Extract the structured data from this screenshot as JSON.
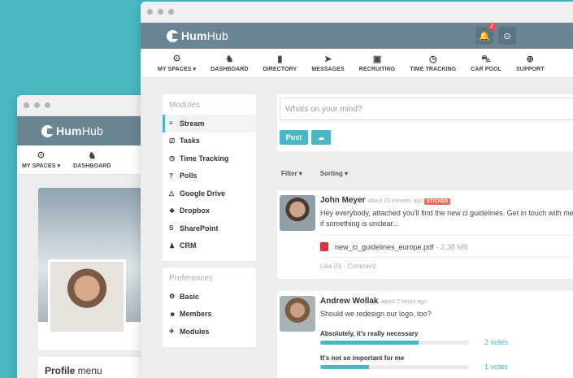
{
  "brand": {
    "logo_prefix": "Hum",
    "logo_suffix": "Hub"
  },
  "back_window": {
    "nav": [
      {
        "icon": "⊙",
        "label": "MY SPACES ▾"
      },
      {
        "icon": "♞",
        "label": "DASHBOARD"
      }
    ],
    "profile_menu": {
      "bold": "Profile",
      "rest": " menu"
    }
  },
  "front_window": {
    "notification_count": "2",
    "nav": [
      {
        "icon": "⊙",
        "label": "MY SPACES ▾"
      },
      {
        "icon": "♞",
        "label": "DASHBOARD"
      },
      {
        "icon": "▮",
        "label": "DIRECTORY"
      },
      {
        "icon": "➤",
        "label": "MESSAGES"
      },
      {
        "icon": "▣",
        "label": "RECRUITING"
      },
      {
        "icon": "◷",
        "label": "TIME TRACKING"
      },
      {
        "icon": "⛍",
        "label": "CAR POOL"
      },
      {
        "icon": "⊕",
        "label": "SUPPORT"
      }
    ],
    "modules": {
      "title": "Modules",
      "items": [
        {
          "icon": "≡",
          "label": "Stream"
        },
        {
          "icon": "☑",
          "label": "Tasks"
        },
        {
          "icon": "◷",
          "label": "Time Tracking"
        },
        {
          "icon": "?",
          "label": "Polls"
        },
        {
          "icon": "△",
          "label": "Google Drive"
        },
        {
          "icon": "❖",
          "label": "Dropbox"
        },
        {
          "icon": "S",
          "label": "SharePoint"
        },
        {
          "icon": "♟",
          "label": "CRM"
        }
      ]
    },
    "preferences": {
      "title": "Preferences",
      "items": [
        {
          "icon": "⚙",
          "label": "Basic"
        },
        {
          "icon": "☻",
          "label": "Members"
        },
        {
          "icon": "✈",
          "label": "Modules"
        }
      ]
    },
    "composer": {
      "placeholder": "Whats on your mind?",
      "post_label": "Post",
      "upload_icon": "☁"
    },
    "filters": {
      "filter": "Filter ▾",
      "sorting": "Sorting ▾"
    },
    "posts": [
      {
        "author": "John Meyer",
        "time": "about 23 minutes ago",
        "badge": "STICKED",
        "text": "Hey everybody, attached you'll find the new ci guidelines. Get in touch with me if something is unclear...",
        "file": "new_ci_guidelines_europe.pdf",
        "file_size": "- 2,38 MB",
        "actions": "Like (0) · Comment"
      },
      {
        "author": "Andrew Wollak",
        "time": "about 2 hours ago",
        "text": "Should we redesign our logo, too?",
        "poll": [
          {
            "label": "Absolutely, it's really necessary",
            "votes": "2 votes",
            "fraction": 0.66
          },
          {
            "label": "It's not so important for me",
            "votes": "1 votes",
            "fraction": 0.33
          }
        ]
      }
    ]
  }
}
